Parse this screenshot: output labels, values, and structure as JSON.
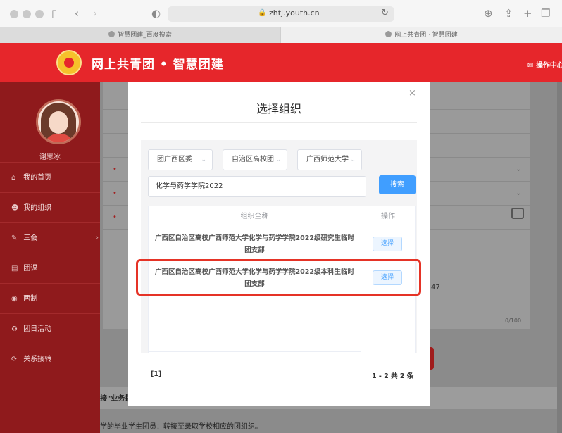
{
  "browser": {
    "url": "zhtj.youth.cn",
    "tabs": [
      {
        "label": "智慧团建_百度搜索"
      },
      {
        "label": "网上共青团 · 智慧团建"
      }
    ]
  },
  "header": {
    "title": "网上共青团 • 智慧团建",
    "ops_label": "✉ 操作中心"
  },
  "sidebar": {
    "user_name": "谢思冰",
    "items": [
      {
        "icon": "home-icon",
        "glyph": "⌂",
        "label": "我的首页"
      },
      {
        "icon": "group-icon",
        "glyph": "☻",
        "label": "我的组织"
      },
      {
        "icon": "edit-icon",
        "glyph": "✎",
        "label": "三会"
      },
      {
        "icon": "folder-icon",
        "glyph": "▤",
        "label": "团课"
      },
      {
        "icon": "circle-icon",
        "glyph": "◉",
        "label": "两制"
      },
      {
        "icon": "recycle-icon",
        "glyph": "♻",
        "label": "团日活动"
      },
      {
        "icon": "transfer-icon",
        "glyph": "⟳",
        "label": "关系接转"
      }
    ]
  },
  "background": {
    "number_fragment": "47",
    "char_counter": "0/100",
    "bottom_fragment": "接\"业务指",
    "bottom_text": "学的毕业学生团员：转接至录取学校相应的团组织。"
  },
  "modal": {
    "title": "选择组织",
    "close": "×",
    "selects": [
      "团广西区委",
      "自治区高校团",
      "广西师范大学"
    ],
    "search_value": "化学与药学学院2022",
    "search_button": "搜索",
    "table": {
      "col_org": "组织全称",
      "col_op": "操作",
      "rows": [
        {
          "org": "广西区自治区高校广西师范大学化学与药学学院2022级研究生临时团支部",
          "action": "选择"
        },
        {
          "org": "广西区自治区高校广西师范大学化学与药学学院2022级本科生临时团支部",
          "action": "选择"
        }
      ]
    },
    "pager_left": "[1]",
    "pager_right": "1 - 2  共 2 条"
  },
  "colors": {
    "header_red": "#e6262b",
    "sidebar_red": "#8f1a1c",
    "primary_blue": "#409eff",
    "highlight_red": "#e53326"
  }
}
